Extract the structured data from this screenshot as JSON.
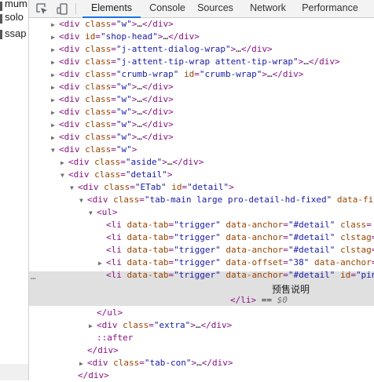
{
  "page_strip": {
    "items": [
      "mum",
      "solo",
      "ssap"
    ]
  },
  "toolbar": {
    "icons": [
      "inspect-element-icon",
      "device-toolbar-icon"
    ],
    "tabs": [
      {
        "label": "Elements",
        "active": true
      },
      {
        "label": "Console",
        "active": false
      },
      {
        "label": "Sources",
        "active": false
      },
      {
        "label": "Network",
        "active": false
      },
      {
        "label": "Performance",
        "active": false
      }
    ]
  },
  "tree": {
    "ellipsis": "…",
    "div": "div",
    "ul": "ul",
    "li": "li",
    "class_attr": "class",
    "id_attr": "id",
    "data_tab_attr": "data-tab",
    "data_anchor_attr": "data-anchor",
    "data_offset_attr": "data-offset",
    "clstag_attr": "clstag",
    "data_fix_attr": "data-fix",
    "val_w": "\"w\"",
    "val_shop_head": "\"shop-head\"",
    "val_j_attent_dialog_wrap": "\"j-attent-dialog-wrap\"",
    "val_j_attent_tip_wrap": "\"j-attent-tip-wrap attent-tip-wrap\"",
    "val_crumb_wrap": "\"crumb-wrap\"",
    "val_aside": "\"aside\"",
    "val_detail": "\"detail\"",
    "val_etab": "\"ETab\"",
    "val_tab_main": "\"tab-main large pro-detail-hd-fixed\"",
    "val_trigger": "\"trigger\"",
    "val_hash_detail": "\"#detail\"",
    "val_38": "\"38\"",
    "val_extra": "\"extra\"",
    "val_tab_con": "\"tab-con\"",
    "id_pin": "\"pin",
    "after": "::after",
    "eq_dollar": " == ",
    "dollar_zero": "$0",
    "tooltip": "预售说明",
    "row_menu": "…"
  }
}
